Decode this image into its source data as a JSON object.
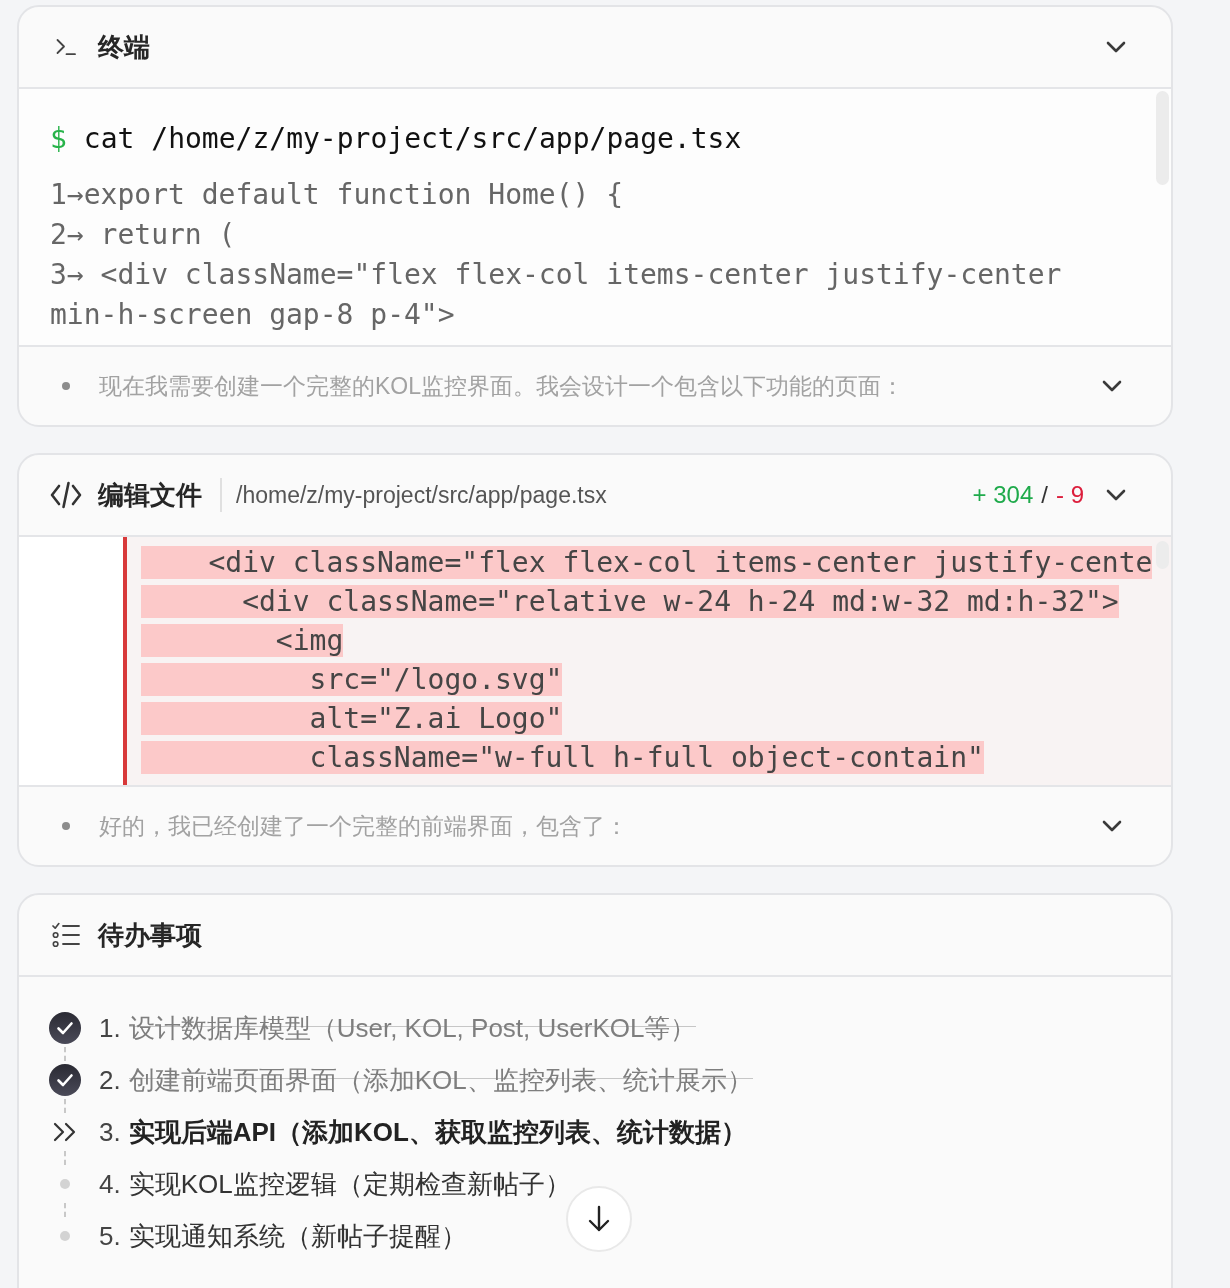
{
  "terminal": {
    "title": "终端",
    "prompt": "$",
    "command": "cat /home/z/my-project/src/app/page.tsx",
    "output": [
      "1→export default function Home() {",
      "2→ return (",
      "3→ <div className=\"flex flex-col items-center justify-center min-h-screen gap-8 p-4\">"
    ],
    "summary": "现在我需要创建一个完整的KOL监控界面。我会设计一个包含以下功能的页面："
  },
  "edit_file": {
    "title": "编辑文件",
    "path": "/home/z/my-project/src/app/page.tsx",
    "added": "+ 304",
    "separator": "/",
    "removed": "- 9",
    "lines": [
      {
        "kind": "removed",
        "text": "    <div className=\"flex flex-col items-center justify-cente"
      },
      {
        "kind": "removed",
        "text": "      <div className=\"relative w-24 h-24 md:w-32 md:h-32\">"
      },
      {
        "kind": "removed",
        "text": "        <img"
      },
      {
        "kind": "removed",
        "text": "          src=\"/logo.svg\""
      },
      {
        "kind": "removed",
        "text": "          alt=\"Z.ai Logo\""
      },
      {
        "kind": "removed",
        "text": "          className=\"w-full h-full object-contain\""
      }
    ],
    "summary": "好的，我已经创建了一个完整的前端界面，包含了："
  },
  "todos": {
    "title": "待办事项",
    "items": [
      {
        "number": "1.",
        "text": "设计数据库模型（User, KOL, Post, UserKOL等）",
        "kind": "done"
      },
      {
        "number": "2.",
        "text": "创建前端页面界面（添加KOL、监控列表、统计展示）",
        "kind": "done"
      },
      {
        "number": "3.",
        "text": "实现后端API（添加KOL、获取监控列表、统计数据）",
        "kind": "in_progress"
      },
      {
        "number": "4.",
        "text": "实现KOL监控逻辑（定期检查新帖子）",
        "kind": "pending"
      },
      {
        "number": "5.",
        "text": "实现通知系统（新帖子提醒）",
        "kind": "pending"
      }
    ]
  }
}
